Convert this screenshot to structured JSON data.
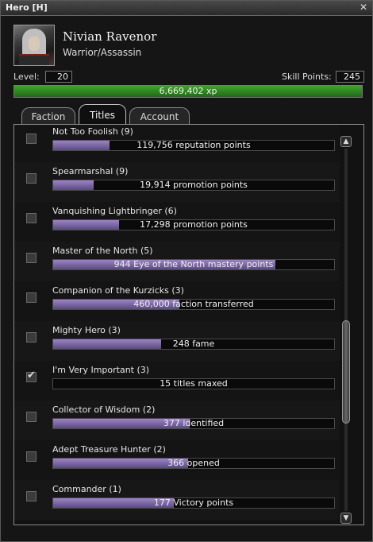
{
  "window": {
    "title": "Hero  [H]",
    "close_label": "✕"
  },
  "character": {
    "name": "Nivian Ravenor",
    "profession": "Warrior/Assassin"
  },
  "stats": {
    "level_label": "Level:",
    "level_value": "20",
    "skill_points_label": "Skill Points:",
    "skill_points_value": "245",
    "xp_text": "6,669,402 xp",
    "xp_fill_fraction": 1.0
  },
  "tabs": [
    {
      "label": "Faction",
      "active": false
    },
    {
      "label": "Titles",
      "active": true
    },
    {
      "label": "Account",
      "active": false
    }
  ],
  "titles": [
    {
      "name": "Not Too Foolish (9)",
      "progress_text": "119,756 reputation points",
      "fill_fraction": 0.2,
      "checked": false
    },
    {
      "name": "Spearmarshal (9)",
      "progress_text": "19,914 promotion points",
      "fill_fraction": 0.145,
      "checked": false
    },
    {
      "name": "Vanquishing Lightbringer (6)",
      "progress_text": "17,298 promotion points",
      "fill_fraction": 0.235,
      "checked": false
    },
    {
      "name": "Master of the North (5)",
      "progress_text": "944 Eye of the North mastery points",
      "fill_fraction": 0.79,
      "checked": false
    },
    {
      "name": "Companion of the Kurzicks (3)",
      "progress_text": "460,000 faction transferred",
      "fill_fraction": 0.45,
      "checked": false
    },
    {
      "name": "Mighty Hero (3)",
      "progress_text": "248 fame",
      "fill_fraction": 0.385,
      "checked": false
    },
    {
      "name": "I'm Very Important (3)",
      "progress_text": "15 titles maxed",
      "fill_fraction": 0.0,
      "checked": true
    },
    {
      "name": "Collector of Wisdom (2)",
      "progress_text": "377 identified",
      "fill_fraction": 0.485,
      "checked": false
    },
    {
      "name": "Adept Treasure Hunter (2)",
      "progress_text": "366 opened",
      "fill_fraction": 0.48,
      "checked": false
    },
    {
      "name": "Commander (1)",
      "progress_text": "177 Victory points",
      "fill_fraction": 0.43,
      "checked": false
    }
  ],
  "scrollbar": {
    "up_icon": "▲",
    "down_icon": "▼"
  },
  "colors": {
    "xp_bar": "#3fa32b",
    "title_bar": "#9d86c2"
  }
}
